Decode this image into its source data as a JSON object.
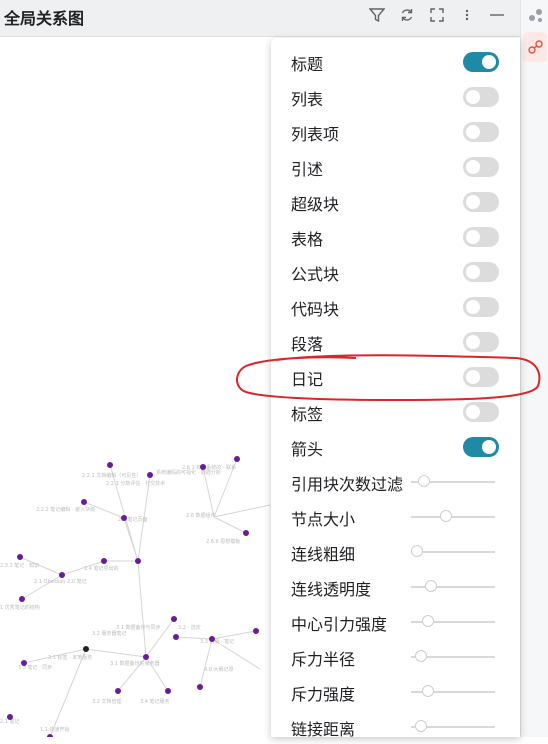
{
  "header": {
    "title": "全局关系图",
    "icons": [
      "filter-icon",
      "refresh-icon",
      "fullscreen-icon",
      "more-icon",
      "minimize-icon"
    ]
  },
  "right_dock": {
    "icons": [
      "graph-icon",
      "global-graph-icon"
    ]
  },
  "filters": {
    "toggles": [
      {
        "label": "标题",
        "on": true
      },
      {
        "label": "列表",
        "on": false
      },
      {
        "label": "列表项",
        "on": false
      },
      {
        "label": "引述",
        "on": false
      },
      {
        "label": "超级块",
        "on": false
      },
      {
        "label": "表格",
        "on": false
      },
      {
        "label": "公式块",
        "on": false
      },
      {
        "label": "代码块",
        "on": false
      },
      {
        "label": "段落",
        "on": false
      },
      {
        "label": "日记",
        "on": false
      },
      {
        "label": "标签",
        "on": false
      },
      {
        "label": "箭头",
        "on": true
      }
    ],
    "sliders": [
      {
        "label": "引用块次数过滤",
        "value": 0.1
      },
      {
        "label": "节点大小",
        "value": 0.4
      },
      {
        "label": "连线粗细",
        "value": 0.0
      },
      {
        "label": "连线透明度",
        "value": 0.2
      },
      {
        "label": "中心引力强度",
        "value": 0.15
      },
      {
        "label": "斥力半径",
        "value": 0.05
      },
      {
        "label": "斥力强度",
        "value": 0.15
      },
      {
        "label": "链接距离",
        "value": 0.05
      }
    ]
  },
  "colors": {
    "accent": "#1f8aa5",
    "node": "#6a1b9a",
    "annotation": "#d9262a"
  }
}
